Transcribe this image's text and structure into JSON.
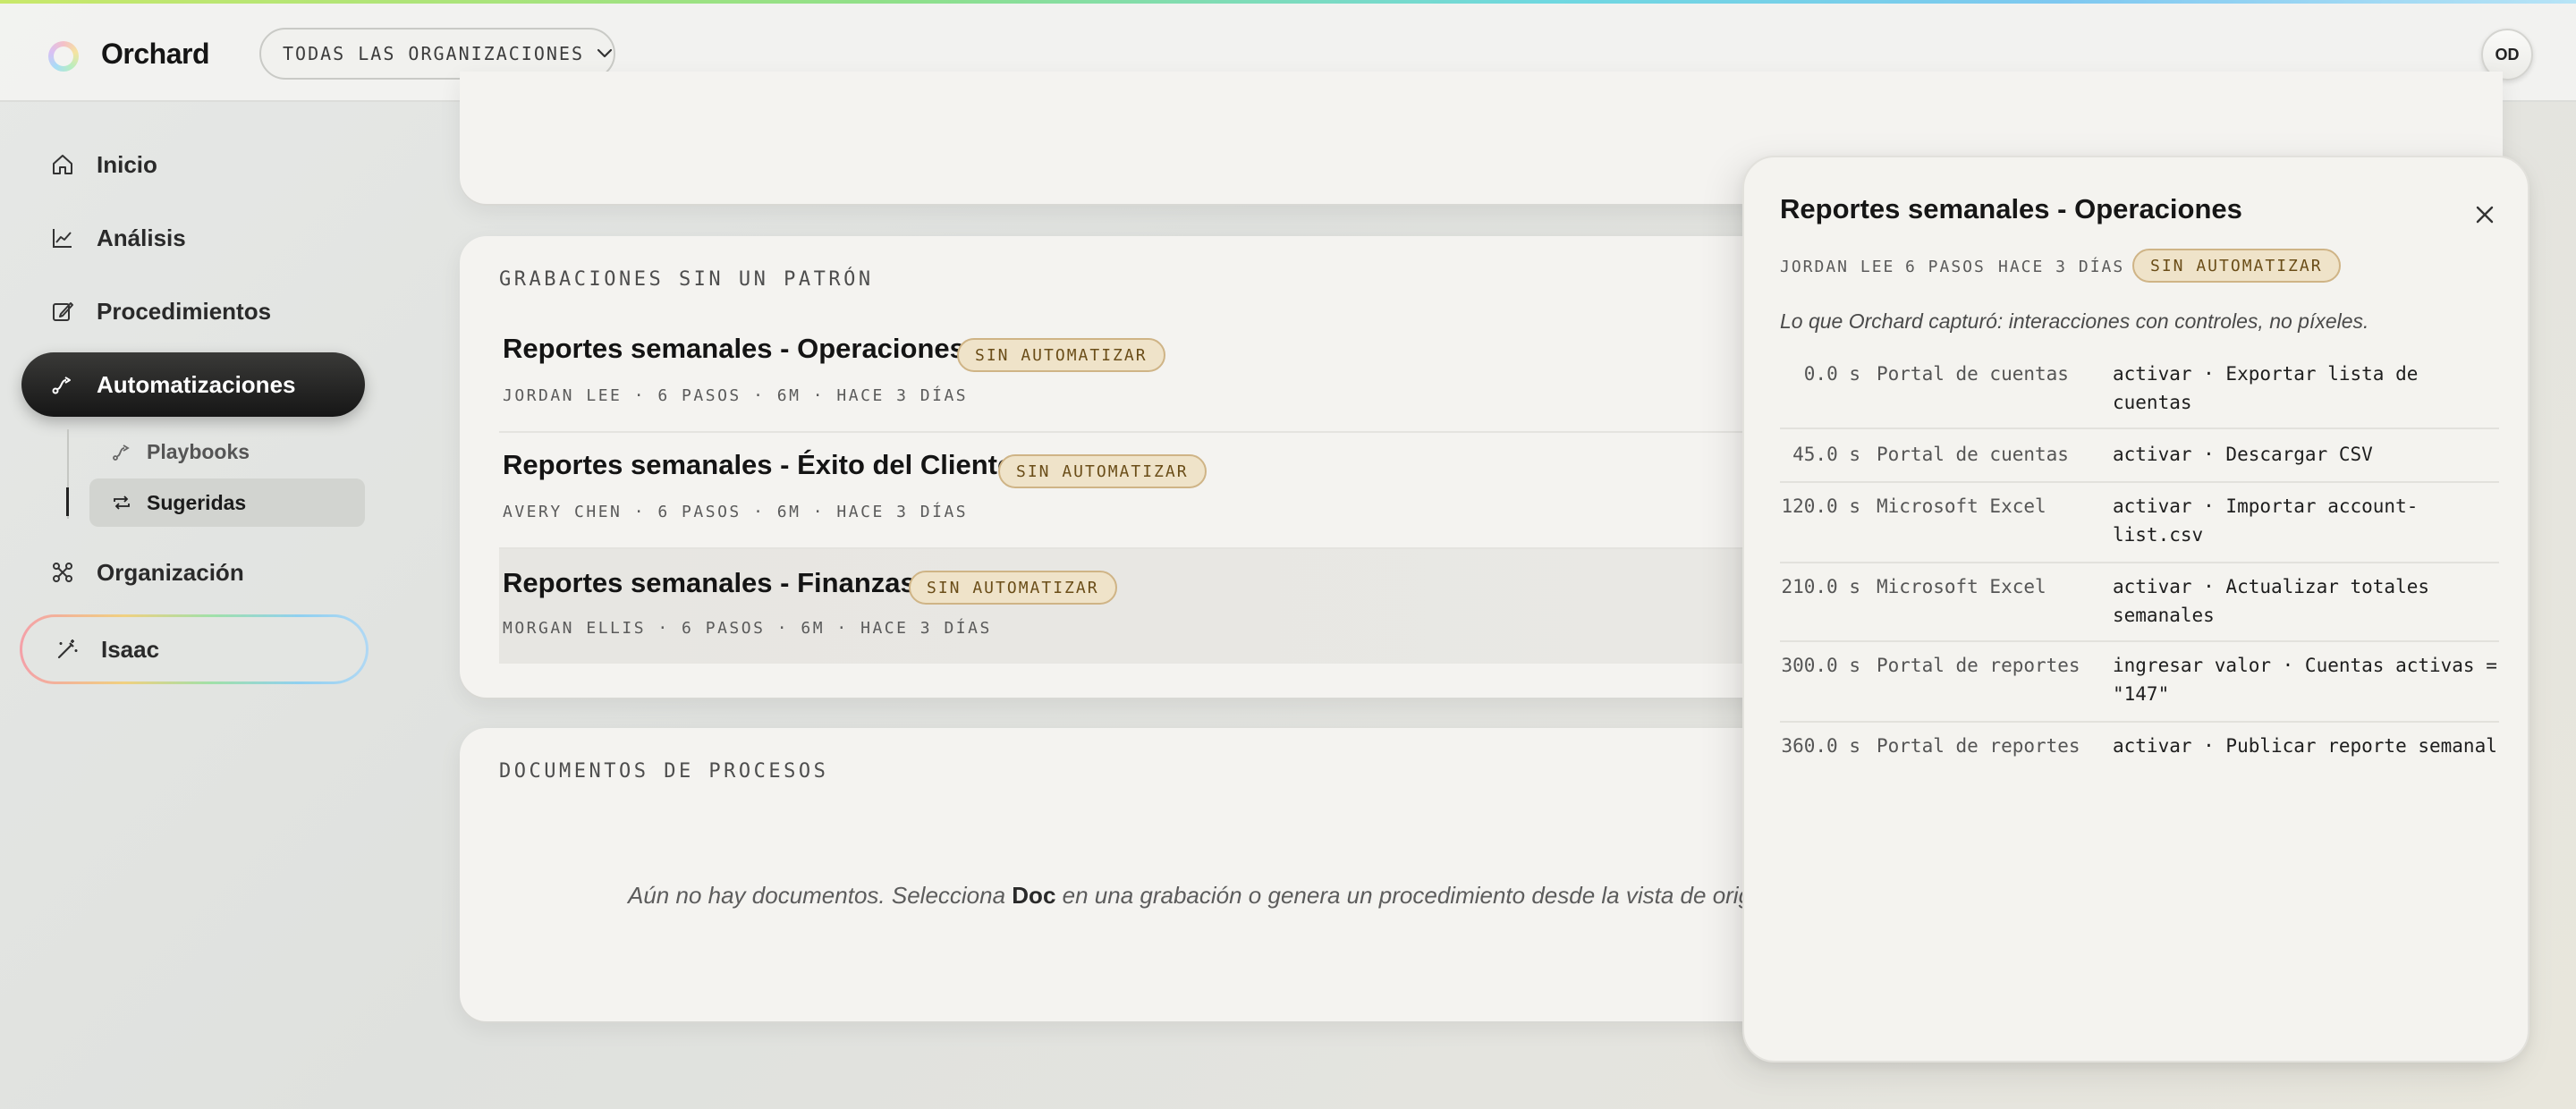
{
  "app": {
    "brand": "Orchard",
    "org_selector": "TODAS LAS ORGANIZACIONES",
    "avatar_initials": "OD",
    "accent_gradient": [
      "#c9e86a",
      "#6fd8e0",
      "#b7e4f6"
    ]
  },
  "sidebar": {
    "items": [
      {
        "label": "Inicio",
        "icon": "home-icon"
      },
      {
        "label": "Análisis",
        "icon": "chart-icon"
      },
      {
        "label": "Procedimientos",
        "icon": "edit-icon"
      },
      {
        "label": "Automatizaciones",
        "icon": "automation-icon",
        "active": true
      },
      {
        "label": "Organización",
        "icon": "org-icon"
      },
      {
        "label": "Isaac",
        "icon": "magic-wand-icon"
      }
    ],
    "sub_items": [
      {
        "label": "Playbooks",
        "icon": "playbook-icon"
      },
      {
        "label": "Sugeridas",
        "icon": "repeat-icon",
        "active": true
      }
    ]
  },
  "recordings": {
    "section_label": "GRABACIONES SIN UN PATRÓN",
    "rows": [
      {
        "title": "Reportes semanales - Operaciones",
        "badge": "SIN AUTOMATIZAR",
        "meta": "JORDAN LEE · 6 PASOS · 6M · HACE 3 DÍAS"
      },
      {
        "title": "Reportes semanales - Éxito del Cliente",
        "badge": "SIN AUTOMATIZAR",
        "meta": "AVERY CHEN · 6 PASOS · 6M · HACE 3 DÍAS"
      },
      {
        "title": "Reportes semanales - Finanzas",
        "badge": "SIN AUTOMATIZAR",
        "meta": "MORGAN ELLIS · 6 PASOS · 6M · HACE 3 DÍAS"
      }
    ]
  },
  "documents": {
    "section_label": "DOCUMENTOS DE PROCESOS",
    "empty_prefix": "Aún no hay documentos. Selecciona ",
    "empty_bold": "Doc",
    "empty_suffix": " en una grabación o genera un procedimiento desde la vista de origen."
  },
  "panel": {
    "title": "Reportes semanales - Operaciones",
    "author": "JORDAN LEE",
    "steps": "6 PASOS",
    "when": "HACE 3 DÍAS",
    "badge": "SIN AUTOMATIZAR",
    "caption": "Lo que Orchard capturó: interacciones con controles, no píxeles.",
    "events": [
      {
        "time": "0.0 s",
        "app": "Portal de cuentas",
        "action": "activar · Exportar lista de cuentas"
      },
      {
        "time": "45.0 s",
        "app": "Portal de cuentas",
        "action": "activar · Descargar CSV"
      },
      {
        "time": "120.0 s",
        "app": "Microsoft Excel",
        "action": "activar · Importar account-list.csv"
      },
      {
        "time": "210.0 s",
        "app": "Microsoft Excel",
        "action": "activar · Actualizar totales semanales"
      },
      {
        "time": "300.0 s",
        "app": "Portal de reportes",
        "action": "ingresar valor · Cuentas activas = \"147\""
      },
      {
        "time": "360.0 s",
        "app": "Portal de reportes",
        "action": "activar · Publicar reporte semanal"
      }
    ]
  }
}
